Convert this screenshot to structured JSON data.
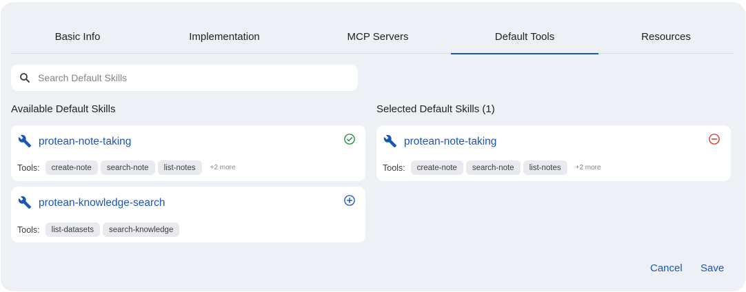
{
  "tabs": [
    {
      "label": "Basic Info"
    },
    {
      "label": "Implementation"
    },
    {
      "label": "MCP Servers"
    },
    {
      "label": "Default Tools",
      "active": true
    },
    {
      "label": "Resources"
    }
  ],
  "search": {
    "placeholder": "Search Default Skills",
    "icon": "search-icon"
  },
  "available": {
    "title": "Available Default Skills",
    "skills": [
      {
        "name": "protean-note-taking",
        "tools_label": "Tools:",
        "tools": [
          "create-note",
          "search-note",
          "list-notes"
        ],
        "more": "+2 more",
        "status_icon": "check-circle-icon"
      },
      {
        "name": "protean-knowledge-search",
        "tools_label": "Tools:",
        "tools": [
          "list-datasets",
          "search-knowledge"
        ],
        "status_icon": "add-circle-icon"
      }
    ]
  },
  "selected": {
    "title": "Selected Default Skills (1)",
    "skills": [
      {
        "name": "protean-note-taking",
        "tools_label": "Tools:",
        "tools": [
          "create-note",
          "search-note",
          "list-notes"
        ],
        "more": "+2 more",
        "status_icon": "remove-circle-icon"
      }
    ]
  },
  "footer": {
    "cancel_label": "Cancel",
    "save_label": "Save"
  },
  "colors": {
    "accent": "#1a56b8",
    "check": "#1e8e3e",
    "remove": "#d93025",
    "panel_bg": "#edf0f5"
  }
}
